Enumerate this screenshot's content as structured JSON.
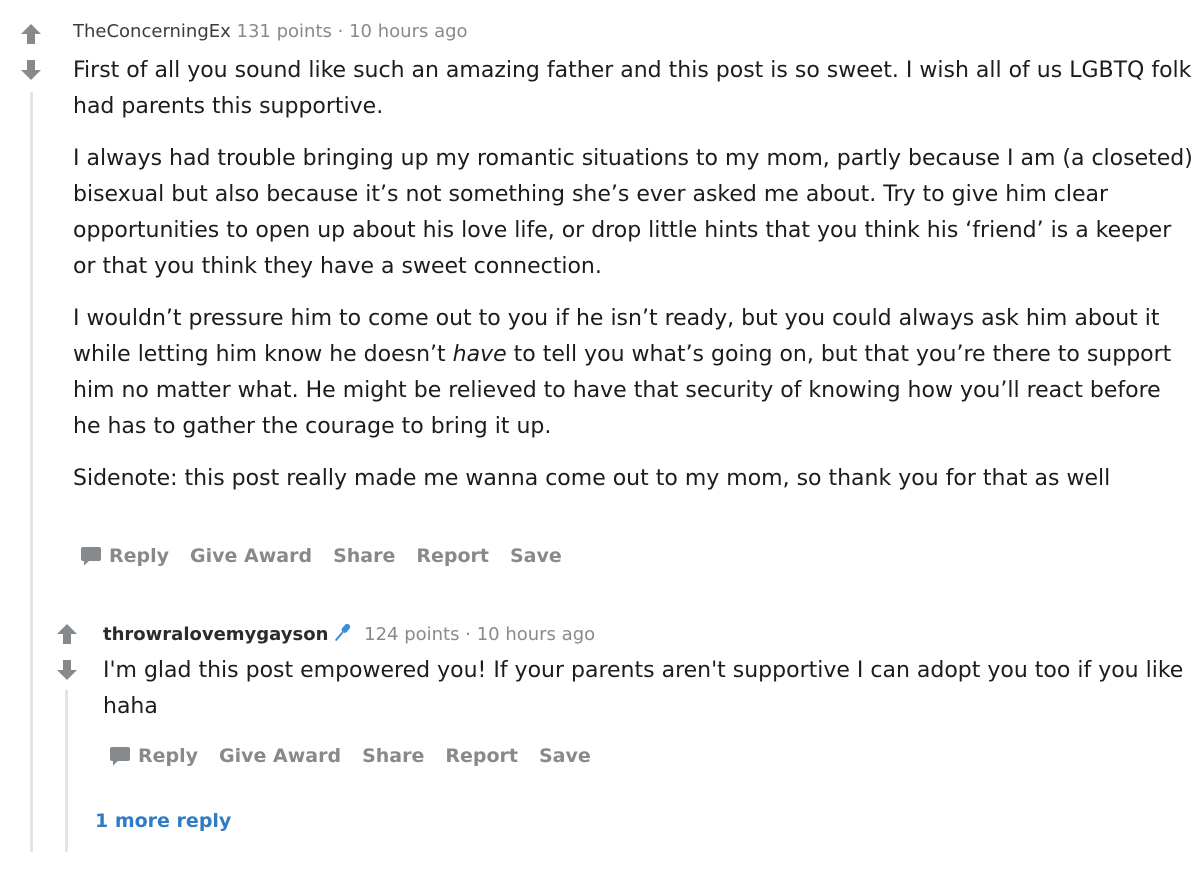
{
  "comments": [
    {
      "author": "TheConcerningEx",
      "points": "131 points",
      "separator": "·",
      "time": "10 hours ago",
      "body": [
        "First of all you sound like such an amazing father and this post is so sweet. I wish all of us LGBTQ folk had parents this supportive.",
        "I always had trouble bringing up my romantic situations to my mom, partly because I am (a closeted) bisexual but also because it’s not something she’s ever asked me about. Try to give him clear opportunities to open up about his love life, or drop little hints that you think his ‘friend’ is a keeper or that you think they have a sweet connection.",
        {
          "before": "I wouldn’t pressure him to come out to you if he isn’t ready, but you could always ask him about it while letting him know he doesn’t ",
          "emphasis": "have",
          "after": " to tell you what’s going on, but that you’re there to support him no matter what. He might be relieved to have that security of knowing how you’ll react before he has to gather the courage to bring it up."
        },
        "Sidenote: this post really made me wanna come out to my mom, so thank you for that as well"
      ],
      "actions": {
        "reply": "Reply",
        "give_award": "Give Award",
        "share": "Share",
        "report": "Report",
        "save": "Save"
      }
    },
    {
      "author": "throwralovemygayson",
      "flair_icon": "microphone-icon",
      "points": "124 points",
      "separator": "·",
      "time": "10 hours ago",
      "body": [
        "I'm glad this post empowered you! If your parents aren't supportive I can adopt you too if you like haha"
      ],
      "actions": {
        "reply": "Reply",
        "give_award": "Give Award",
        "share": "Share",
        "report": "Report",
        "save": "Save"
      }
    }
  ],
  "more_replies": "1 more reply",
  "colors": {
    "meta_gray": "#8a8a8a",
    "action_gray": "#878a8c",
    "link_blue": "#2f7bc4",
    "thread_line": "#e4e4e4",
    "mic_blue": "#3a8fd8"
  }
}
